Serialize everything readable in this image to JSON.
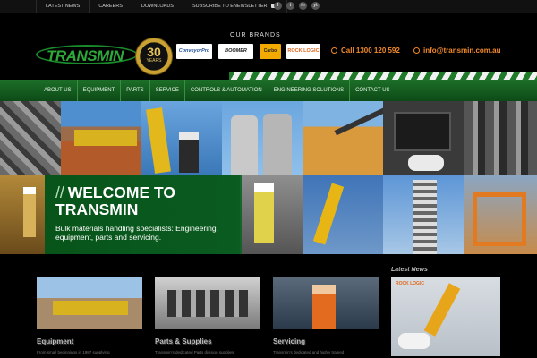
{
  "topbar": {
    "links": [
      "LATEST NEWS",
      "CAREERS",
      "DOWNLOADS",
      "SUBSCRIBE TO ENEWSLETTER"
    ],
    "social": [
      "f",
      "t",
      "in",
      "yt"
    ]
  },
  "header": {
    "logo_text": "TRANSMIN",
    "seal_number": "30",
    "seal_caption": "YEARS",
    "brands_title": "OUR BRANDS",
    "brands": [
      "ConveyorPro",
      "BOOMER",
      "Carbo",
      "ROCK LOGIC"
    ],
    "phone": "Call 1300 120 592",
    "email": "info@transmin.com.au"
  },
  "nav": {
    "items": [
      "ABOUT US",
      "EQUIPMENT",
      "PARTS",
      "SERVICE",
      "CONTROLS & AUTOMATION",
      "ENGINEERING SOLUTIONS",
      "CONTACT US"
    ]
  },
  "hero": {
    "slashes": "//",
    "heading_line1": "WELCOME TO",
    "heading_line2": "TRANSMIN",
    "tagline": "Bulk materials handling specialists: Engineering, equipment, parts and servicing."
  },
  "cards": [
    {
      "title": "Equipment",
      "text": "From small beginnings in 1987 supplying"
    },
    {
      "title": "Parts & Supplies",
      "text": "Transmin's dedicated Parts division supplies"
    },
    {
      "title": "Servicing",
      "text": "Transmin's dedicated and highly trained"
    }
  ],
  "news": {
    "title": "Latest News",
    "brand": "ROCK LOGIC"
  },
  "colors": {
    "brand_green": "#1d6f28",
    "accent_orange": "#f28a2a",
    "background": "#000000"
  }
}
